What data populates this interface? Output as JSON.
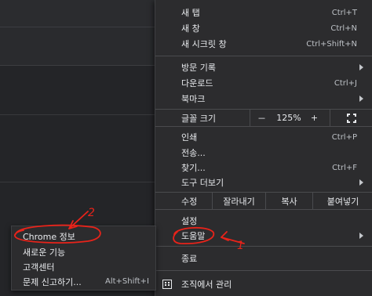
{
  "menu": {
    "new_tab": {
      "label": "새 탭",
      "shortcut": "Ctrl+T"
    },
    "new_window": {
      "label": "새 창",
      "shortcut": "Ctrl+N"
    },
    "new_incognito": {
      "label": "새 시크릿 창",
      "shortcut": "Ctrl+Shift+N"
    },
    "history": {
      "label": "방문 기록"
    },
    "downloads": {
      "label": "다운로드",
      "shortcut": "Ctrl+J"
    },
    "bookmarks": {
      "label": "북마크"
    },
    "zoom": {
      "label": "글꼴 크기",
      "minus": "－",
      "value": "125%",
      "plus": "+"
    },
    "print": {
      "label": "인쇄",
      "shortcut": "Ctrl+P"
    },
    "cast": {
      "label": "전송..."
    },
    "find": {
      "label": "찾기...",
      "shortcut": "Ctrl+F"
    },
    "more_tools": {
      "label": "도구 더보기"
    },
    "edit": {
      "label": "수정",
      "cut": "잘라내기",
      "copy": "복사",
      "paste": "붙여넣기"
    },
    "settings": {
      "label": "설정"
    },
    "help": {
      "label": "도움말"
    },
    "exit": {
      "label": "종료"
    },
    "managed": {
      "label": "조직에서 관리"
    }
  },
  "help_submenu": {
    "about": {
      "label": "Chrome 정보"
    },
    "whats_new": {
      "label": "새로운 기능"
    },
    "help_center": {
      "label": "고객센터"
    },
    "report_issue": {
      "label": "문제 신고하기...",
      "shortcut": "Alt+Shift+I"
    }
  },
  "annotations": {
    "step1": "1",
    "step2": "2",
    "color": "#e8231a"
  },
  "icons": [
    "chevron-right-icon",
    "fullscreen-icon",
    "building-icon"
  ]
}
